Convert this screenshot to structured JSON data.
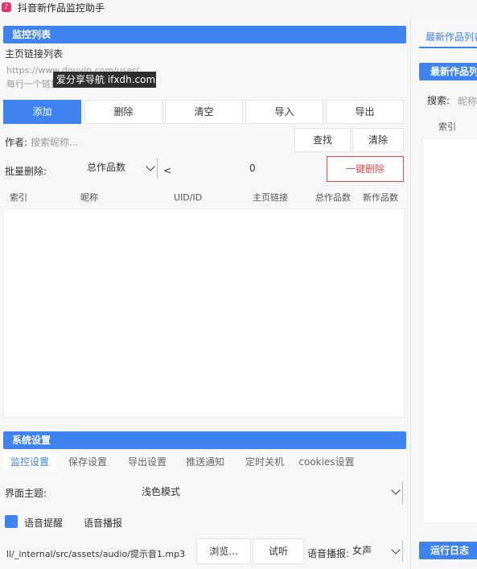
{
  "window": {
    "title": "抖音新作品监控助手",
    "icon": "douyin-icon"
  },
  "monitor": {
    "header": "监控列表",
    "url_label": "主页链接列表",
    "url_hint_1": "https://www.douyin.com/user/...",
    "url_hint_2": "每行一个链接",
    "buttons": {
      "add": "添加",
      "delete": "删除",
      "clear": "清空",
      "import": "导入",
      "export": "导出"
    },
    "author_label": "作者:",
    "author_placeholder": "搜索昵称...",
    "find_button": "查找",
    "clear_button": "清除",
    "batch_label": "批量删除:",
    "batch_select": "总作品数",
    "batch_op": "<",
    "batch_value": "0",
    "batch_delete_button": "一键删除",
    "columns": [
      "索引",
      "昵称",
      "UID/ID",
      "主页链接",
      "总作品数",
      "新作品数"
    ]
  },
  "watermark": "爱分享导航 ifxdh.com",
  "settings": {
    "header": "系统设置",
    "tabs": [
      "监控设置",
      "保存设置",
      "导出设置",
      "推送通知",
      "定时关机",
      "cookies设置"
    ],
    "active_tab": 0,
    "theme_label": "界面主题:",
    "theme_value": "浅色模式",
    "voice_alert_label": "语音提醒",
    "voice_broadcast_label": "语音播报",
    "audio_path": "ll/_internal/src/assets/audio/提示音1.mp3",
    "browse_button": "浏览...",
    "preview_button": "试听",
    "voice_type_label": "语音播报:",
    "voice_type_value": "女声"
  },
  "right": {
    "tab": "最新作品列表",
    "header": "最新作品列表",
    "search_label": "搜索:",
    "search_placeholder": "昵称",
    "index_col": "索引",
    "log_header": "运行日志"
  },
  "colors": {
    "accent": "#3f83f0",
    "danger": "#e04a4a"
  }
}
